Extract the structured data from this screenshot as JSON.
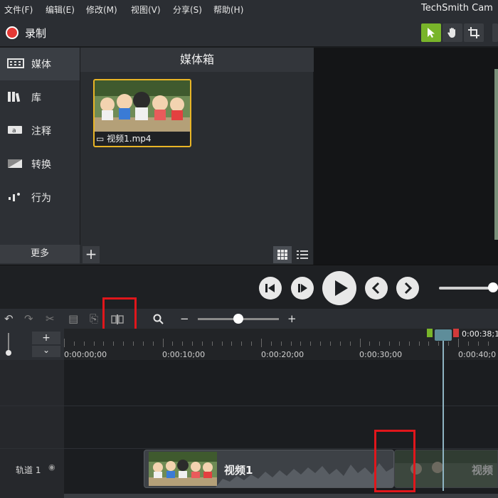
{
  "menubar": {
    "items": [
      "文件(F)",
      "编辑(E)",
      "修改(M)",
      "视图(V)",
      "分享(S)",
      "帮助(H)"
    ],
    "app_title": "TechSmith Cam"
  },
  "recordbar": {
    "record_label": "录制",
    "tools": [
      "pointer-tool-icon",
      "hand-tool-icon",
      "crop-tool-icon"
    ]
  },
  "sidebar": {
    "items": [
      {
        "label": "媒体",
        "icon": "film-icon"
      },
      {
        "label": "库",
        "icon": "library-icon"
      },
      {
        "label": "注释",
        "icon": "annotation-icon"
      },
      {
        "label": "转换",
        "icon": "transition-icon"
      },
      {
        "label": "行为",
        "icon": "behavior-icon"
      }
    ],
    "more_label": "更多",
    "add_label": "+"
  },
  "mediabin": {
    "title": "媒体箱",
    "clips": [
      {
        "name": "视频1.mp4"
      }
    ]
  },
  "timeline": {
    "zoom_minus": "−",
    "zoom_plus": "+",
    "track_add": "+",
    "track_collapse": "⌄",
    "ruler_labels": [
      "0:00:00;00",
      "0:00:10;00",
      "0:00:20;00",
      "0:00:30;00",
      "0:00:40;0"
    ],
    "playhead_time": "0:00:38;1",
    "tracks": [
      {
        "label": "轨道 1"
      }
    ],
    "clip_labels": [
      "视频1",
      "视频"
    ]
  },
  "colors": {
    "accent_green": "#79b52a",
    "record_red": "#e53935",
    "highlight_red": "#e0161b",
    "thumbnail_border": "#e9b526",
    "playhead": "#5e8d9a"
  }
}
